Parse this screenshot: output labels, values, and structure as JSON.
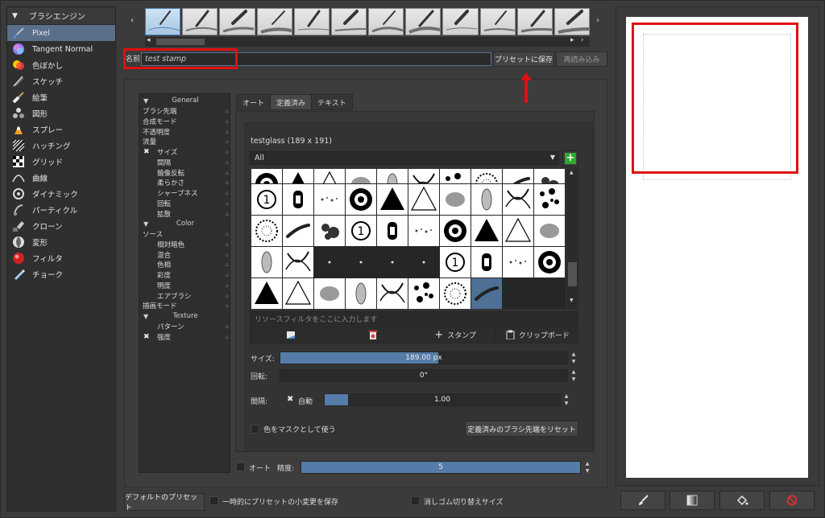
{
  "engine_panel": {
    "header": "ブラシエンジン",
    "items": [
      {
        "label": "Pixel",
        "icon": "pixel-brush-icon",
        "active": true
      },
      {
        "label": "Tangent Normal",
        "icon": "tangent-normal-icon"
      },
      {
        "label": "色ぼかし",
        "icon": "color-smudge-icon"
      },
      {
        "label": "スケッチ",
        "icon": "sketch-icon"
      },
      {
        "label": "絵筆",
        "icon": "bristle-icon"
      },
      {
        "label": "図形",
        "icon": "shape-icon"
      },
      {
        "label": "スプレー",
        "icon": "spray-icon"
      },
      {
        "label": "ハッチング",
        "icon": "hatching-icon"
      },
      {
        "label": "グリッド",
        "icon": "grid-icon"
      },
      {
        "label": "曲線",
        "icon": "curve-icon"
      },
      {
        "label": "ダイナミック",
        "icon": "dynamic-icon"
      },
      {
        "label": "パーティクル",
        "icon": "particle-icon"
      },
      {
        "label": "クローン",
        "icon": "clone-icon"
      },
      {
        "label": "変形",
        "icon": "deform-icon"
      },
      {
        "label": "フィルタ",
        "icon": "filter-icon"
      },
      {
        "label": "チョーク",
        "icon": "chalk-icon"
      }
    ]
  },
  "preset_strip": {
    "left_arrow": "‹",
    "right_arrow": "›",
    "scroll_left": "◂",
    "scroll_right": "▸",
    "page_right": "›"
  },
  "name_row": {
    "label": "名前:",
    "value": "test stamp",
    "save_button": "プリセットに保存",
    "reload_button": "再読み込み"
  },
  "options": [
    {
      "type": "section",
      "label": "General"
    },
    {
      "type": "item",
      "label": "ブラシ先端"
    },
    {
      "type": "item",
      "label": "合成モード"
    },
    {
      "type": "item",
      "label": "不透明度"
    },
    {
      "type": "item",
      "label": "流量"
    },
    {
      "type": "check",
      "label": "サイズ",
      "checked": true
    },
    {
      "type": "check",
      "label": "間隔",
      "checked": false
    },
    {
      "type": "check",
      "label": "鏡像反転",
      "checked": false
    },
    {
      "type": "check",
      "label": "柔らかさ",
      "checked": false
    },
    {
      "type": "check",
      "label": "シャープネス",
      "checked": false
    },
    {
      "type": "check",
      "label": "回転",
      "checked": false
    },
    {
      "type": "check",
      "label": "拡散",
      "checked": false
    },
    {
      "type": "section",
      "label": "Color"
    },
    {
      "type": "item",
      "label": "ソース"
    },
    {
      "type": "check",
      "label": "相対暗色",
      "checked": false
    },
    {
      "type": "check",
      "label": "混合",
      "checked": false
    },
    {
      "type": "check",
      "label": "色相",
      "checked": false
    },
    {
      "type": "check",
      "label": "彩度",
      "checked": false
    },
    {
      "type": "check",
      "label": "明度",
      "checked": false
    },
    {
      "type": "check",
      "label": "エアブラシ",
      "checked": false
    },
    {
      "type": "item",
      "label": "描画モード"
    },
    {
      "type": "section",
      "label": "Texture"
    },
    {
      "type": "check",
      "label": "パターン",
      "checked": false
    },
    {
      "type": "check",
      "label": "強度",
      "checked": true
    }
  ],
  "tabs": [
    {
      "label": "オート",
      "active": false
    },
    {
      "label": "定義済み",
      "active": true
    },
    {
      "label": "テキスト",
      "active": false
    }
  ],
  "brush_tip": {
    "name": "testglass (189 x 191)",
    "filter_value": "All",
    "add_label": "+",
    "resource_filter_placeholder": "リソースフィルタをここに入力します",
    "buttons": {
      "stamp": "スタンプ",
      "clipboard": "クリップボード"
    }
  },
  "size": {
    "label": "サイズ:",
    "value": "189.00 px",
    "fraction": 0.55
  },
  "rotation": {
    "label": "回転:",
    "value": "0°",
    "fraction": 0.0
  },
  "spacing": {
    "label": "間隔:",
    "auto_label": "自動",
    "auto_checked": true,
    "value": "1.00",
    "fraction": 0.1
  },
  "mask_checkbox": {
    "label": "色をマスクとして使う",
    "checked": false
  },
  "reset_button": "定義済みのブラシ先端をリセット",
  "precision": {
    "auto_label": "オート",
    "auto_checked": false,
    "label": "精度:",
    "value": "5",
    "fraction": 1.0
  },
  "footer": {
    "default_preset_button": "デフォルトのプリセット",
    "temp_save_label": "一時的にプリセットの小変更を保存",
    "eraser_label": "消しゴム切り替えサイズ"
  },
  "colors": {
    "accent": "#557ca8",
    "selection": "#5a6f8c",
    "annotation": "#e01010"
  }
}
